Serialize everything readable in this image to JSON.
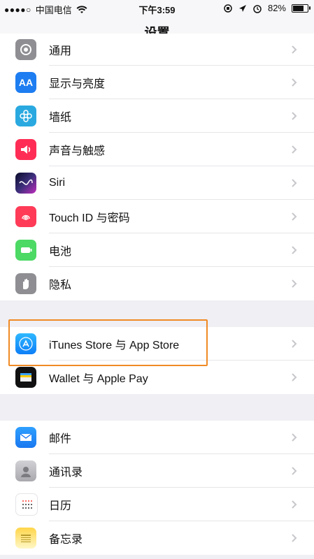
{
  "status_bar": {
    "signal": "●●●●○",
    "carrier": "中国电信",
    "time": "下午3:59",
    "battery_percent": "82%",
    "battery_level": 0.82
  },
  "nav": {
    "title": "设置"
  },
  "sections": {
    "general": [
      {
        "label": "通用",
        "icon": "gear-icon"
      },
      {
        "label": "显示与亮度",
        "icon": "display-icon"
      },
      {
        "label": "墙纸",
        "icon": "wallpaper-icon"
      },
      {
        "label": "声音与触感",
        "icon": "sound-icon"
      },
      {
        "label": "Siri",
        "icon": "siri-icon"
      },
      {
        "label": "Touch ID 与密码",
        "icon": "fingerprint-icon"
      },
      {
        "label": "电池",
        "icon": "battery-icon"
      },
      {
        "label": "隐私",
        "icon": "hand-icon"
      }
    ],
    "stores": [
      {
        "label": "iTunes Store 与 App Store",
        "icon": "app-store-icon"
      },
      {
        "label": "Wallet 与 Apple Pay",
        "icon": "wallet-icon"
      }
    ],
    "apps": [
      {
        "label": "邮件",
        "icon": "mail-icon"
      },
      {
        "label": "通讯录",
        "icon": "contacts-icon"
      },
      {
        "label": "日历",
        "icon": "calendar-icon"
      },
      {
        "label": "备忘录",
        "icon": "notes-icon"
      }
    ]
  },
  "colors": {
    "highlight": "#f08a24",
    "chevron": "#c7c7cc"
  }
}
